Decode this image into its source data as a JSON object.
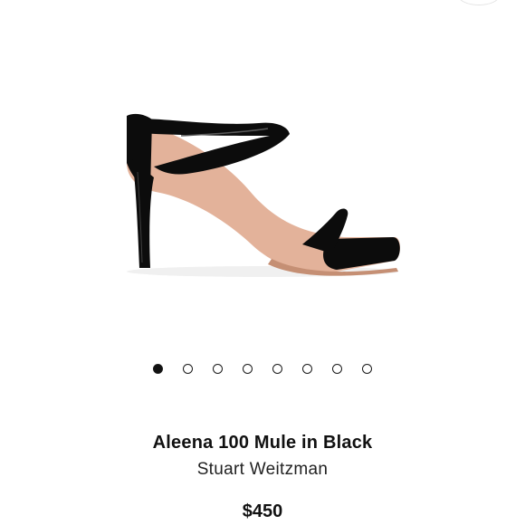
{
  "product": {
    "title": "Aleena 100 Mule in Black",
    "brand": "Stuart Weitzman",
    "price": "$450",
    "image_icon": "sandal-product-image"
  },
  "carousel": {
    "total_images": 8,
    "active_index": 0
  },
  "colors": {
    "patent_black": "#0c0c0c",
    "insole_nude": "#e3b29a"
  }
}
